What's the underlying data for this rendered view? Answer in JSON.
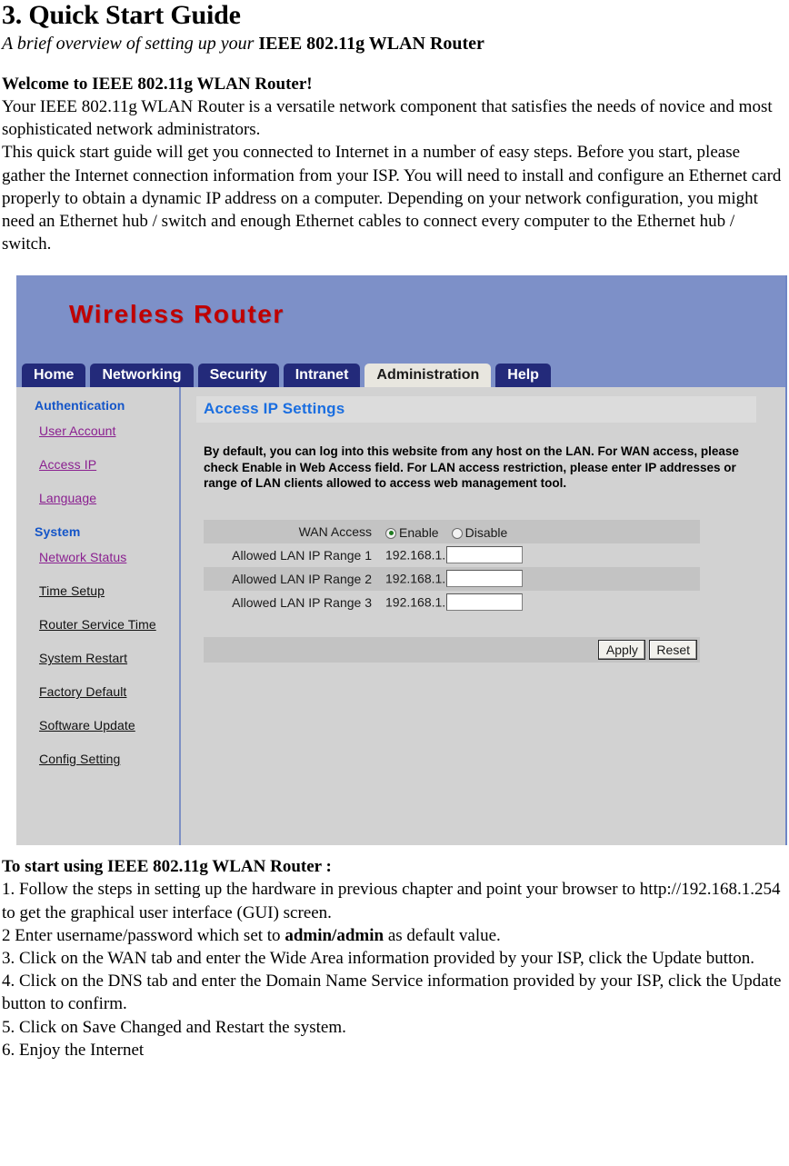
{
  "document": {
    "title": "3. Quick Start Guide",
    "subtitle_italic": "A brief overview of setting up your ",
    "subtitle_bold": "IEEE 802.11g WLAN Router",
    "welcome_heading": "Welcome to IEEE 802.11g WLAN Router!",
    "intro_paragraphs": [
      "Your IEEE 802.11g WLAN Router is a versatile network component that satisfies the needs of novice and most sophisticated network administrators.",
      "This quick start guide will get you connected to Internet in a number of easy steps. Before you start, please gather the Internet connection information from your ISP. You will need to install and configure an Ethernet card properly to obtain a dynamic IP address on a computer. Depending on your network configuration, you might need an Ethernet hub / switch and enough Ethernet cables to connect every computer to the Ethernet hub / switch."
    ],
    "steps_heading": "To start using IEEE 802.11g WLAN Router :",
    "steps": [
      "1. Follow the steps in setting up the hardware in previous chapter and point your browser to http://192.168.1.254 to get the graphical user interface (GUI) screen.",
      "2 Enter username/password which set to admin/admin as default value.",
      "3. Click on the WAN tab and enter the Wide Area information provided by your ISP, click the Update button.",
      "4. Click on the DNS tab and enter the Domain Name Service information provided by your ISP, click the Update button to confirm.",
      "5. Click on Save Changed and Restart the system.",
      "6. Enjoy the Internet"
    ],
    "step2_prefix": "2 Enter username/password which set to ",
    "step2_bold": "admin/admin",
    "step2_suffix": " as default value."
  },
  "router_ui": {
    "logo": "Wireless Router",
    "tabs": [
      {
        "label": "Home",
        "active": false
      },
      {
        "label": "Networking",
        "active": false
      },
      {
        "label": "Security",
        "active": false
      },
      {
        "label": "Intranet",
        "active": false
      },
      {
        "label": "Administration",
        "active": true
      },
      {
        "label": "Help",
        "active": false
      }
    ],
    "sidebar": {
      "group1_heading": "Authentication",
      "group1_links": [
        "User Account",
        "Access IP",
        "Language"
      ],
      "group2_heading": "System",
      "group2_links": [
        "Network Status",
        "Time Setup",
        "Router Service Time",
        "System Restart",
        "Factory Default",
        "Software Update",
        "Config Setting"
      ]
    },
    "panel": {
      "title": "Access IP Settings",
      "description": "By default, you can log into this website from any host on the LAN. For WAN access, please check Enable in Web Access field. For LAN access restriction, please enter IP addresses or range of LAN clients allowed to access web management tool.",
      "wan_access_label": "WAN Access",
      "radio_enable": "Enable",
      "radio_disable": "Disable",
      "wan_access_value": "Enable",
      "ip_prefix": "192.168.1.",
      "rows": [
        {
          "label": "Allowed LAN IP Range 1",
          "prefix": "192.168.1.",
          "value": ""
        },
        {
          "label": "Allowed LAN IP Range 2",
          "prefix": "192.168.1.",
          "value": ""
        },
        {
          "label": "Allowed LAN IP Range 3",
          "prefix": "192.168.1.",
          "value": ""
        }
      ],
      "apply_label": "Apply",
      "reset_label": "Reset"
    },
    "colors": {
      "banner": "#7d90c8",
      "tab": "#232a7a",
      "tab_active": "#e8e6df",
      "logo_red": "#c00000",
      "heading_blue": "#1a6ee0",
      "link_purple": "#8a2090",
      "panel_gray": "#d2d2d2",
      "row_shaded": "#c3c3c3"
    }
  }
}
